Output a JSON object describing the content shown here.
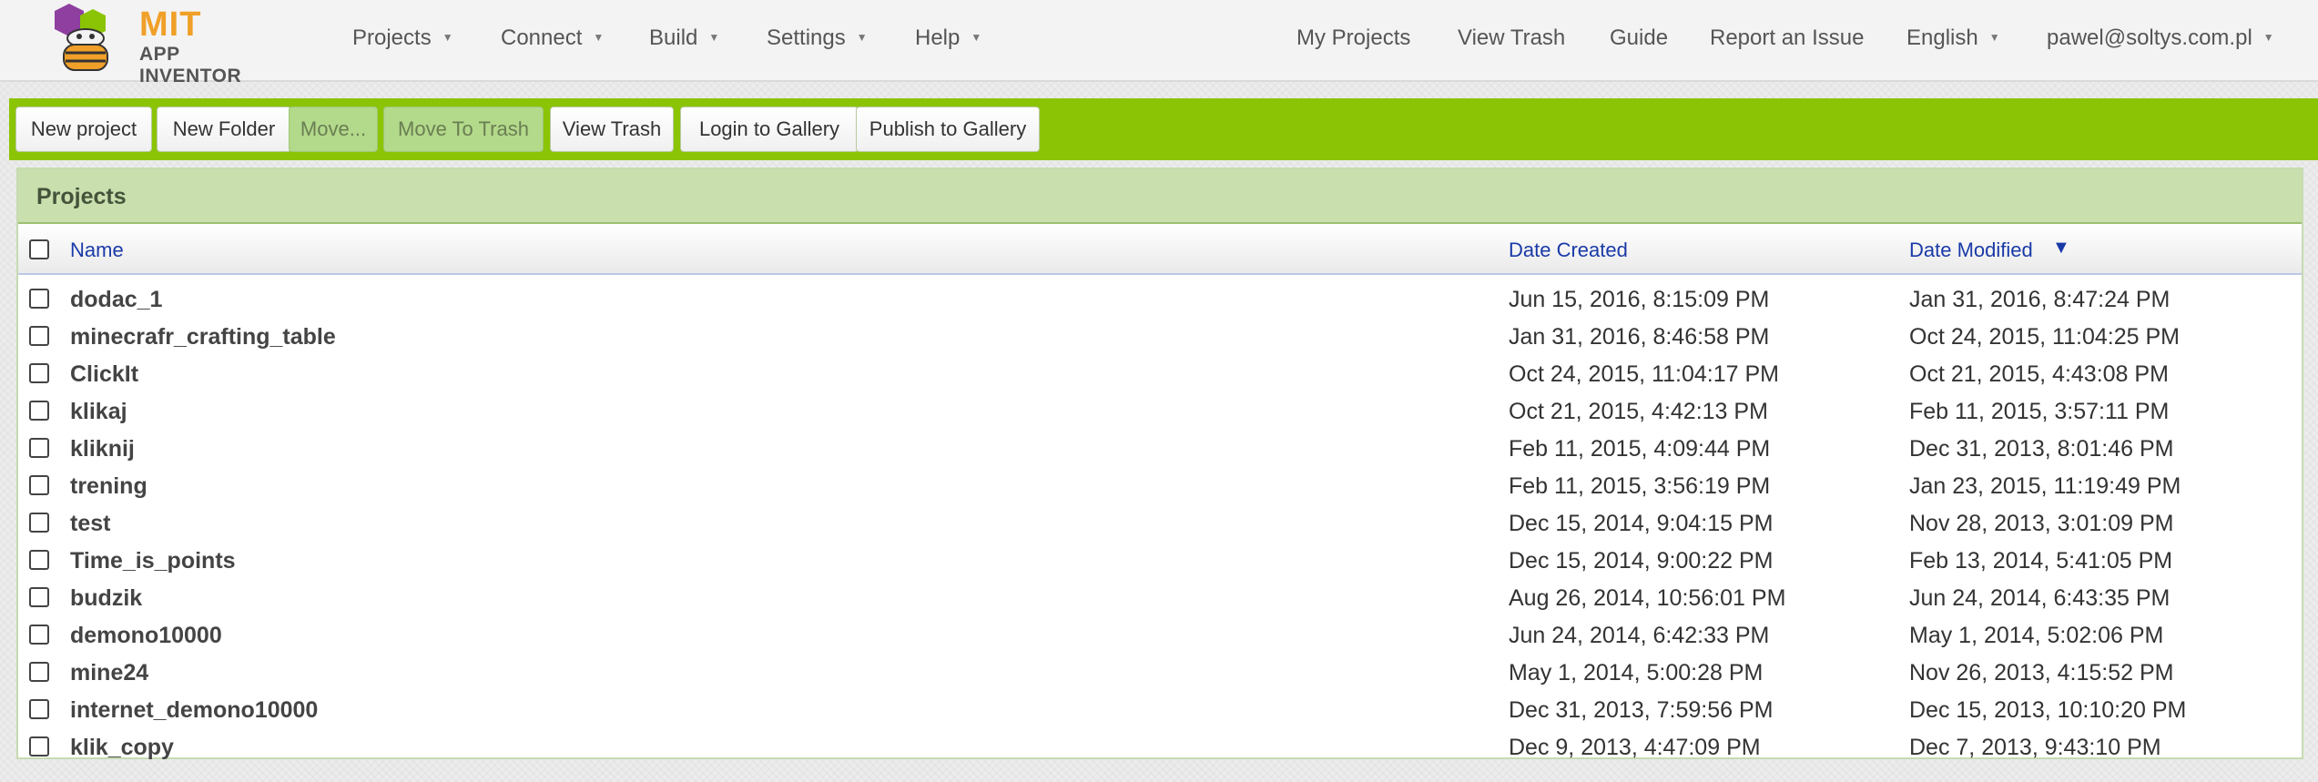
{
  "brand": {
    "title": "MIT",
    "subtitle": "APP INVENTOR",
    "colors": {
      "orange": "#f0a028",
      "purple": "#8e3fa0",
      "green": "#8bc404"
    }
  },
  "nav": {
    "left": [
      {
        "label": "Projects"
      },
      {
        "label": "Connect"
      },
      {
        "label": "Build"
      },
      {
        "label": "Settings"
      },
      {
        "label": "Help"
      }
    ],
    "right": {
      "my_projects": "My Projects",
      "view_trash": "View Trash",
      "guide": "Guide",
      "report_issue": "Report an Issue",
      "language": "English",
      "user": "pawel@soltys.com.pl"
    }
  },
  "toolbar": {
    "new_project": "New project",
    "new_folder": "New Folder",
    "move": "Move...",
    "move_to_trash": "Move To Trash",
    "view_trash": "View Trash",
    "login_gallery": "Login to Gallery",
    "publish_gallery": "Publish to Gallery"
  },
  "projects": {
    "title": "Projects",
    "columns": {
      "name": "Name",
      "date_created": "Date Created",
      "date_modified": "Date Modified",
      "sort_indicator": "▼"
    },
    "rows": [
      {
        "name": "dodac_1",
        "created": "Jun 15, 2016, 8:15:09 PM",
        "modified": "Jan 31, 2016, 8:47:24 PM"
      },
      {
        "name": "minecrafr_crafting_table",
        "created": "Jan 31, 2016, 8:46:58 PM",
        "modified": "Oct 24, 2015, 11:04:25 PM"
      },
      {
        "name": "ClickIt",
        "created": "Oct 24, 2015, 11:04:17 PM",
        "modified": "Oct 21, 2015, 4:43:08 PM"
      },
      {
        "name": "klikaj",
        "created": "Oct 21, 2015, 4:42:13 PM",
        "modified": "Feb 11, 2015, 3:57:11 PM"
      },
      {
        "name": "kliknij",
        "created": "Feb 11, 2015, 4:09:44 PM",
        "modified": "Dec 31, 2013, 8:01:46 PM"
      },
      {
        "name": "trening",
        "created": "Feb 11, 2015, 3:56:19 PM",
        "modified": "Jan 23, 2015, 11:19:49 PM"
      },
      {
        "name": "test",
        "created": "Dec 15, 2014, 9:04:15 PM",
        "modified": "Nov 28, 2013, 3:01:09 PM"
      },
      {
        "name": "Time_is_points",
        "created": "Dec 15, 2014, 9:00:22 PM",
        "modified": "Feb 13, 2014, 5:41:05 PM"
      },
      {
        "name": "budzik",
        "created": "Aug 26, 2014, 10:56:01 PM",
        "modified": "Jun 24, 2014, 6:43:35 PM"
      },
      {
        "name": "demono10000",
        "created": "Jun 24, 2014, 6:42:33 PM",
        "modified": "May 1, 2014, 5:02:06 PM"
      },
      {
        "name": "mine24",
        "created": "May 1, 2014, 5:00:28 PM",
        "modified": "Nov 26, 2013, 4:15:52 PM"
      },
      {
        "name": "internet_demono10000",
        "created": "Dec 31, 2013, 7:59:56 PM",
        "modified": "Dec 15, 2013, 10:10:20 PM"
      },
      {
        "name": "klik_copy",
        "created": "Dec 9, 2013, 4:47:09 PM",
        "modified": "Dec 7, 2013, 9:43:10 PM"
      }
    ]
  }
}
